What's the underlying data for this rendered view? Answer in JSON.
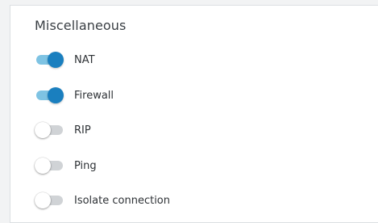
{
  "section": {
    "title": "Miscellaneous"
  },
  "options": [
    {
      "label": "NAT",
      "enabled": true
    },
    {
      "label": "Firewall",
      "enabled": true
    },
    {
      "label": "RIP",
      "enabled": false
    },
    {
      "label": "Ping",
      "enabled": false
    },
    {
      "label": "Isolate connection",
      "enabled": false
    }
  ],
  "colors": {
    "toggle_on_knob": "#1a7fbf",
    "toggle_on_track": "#7ec3e3",
    "toggle_off_track": "#d0d3d6",
    "toggle_off_knob": "#ffffff"
  }
}
